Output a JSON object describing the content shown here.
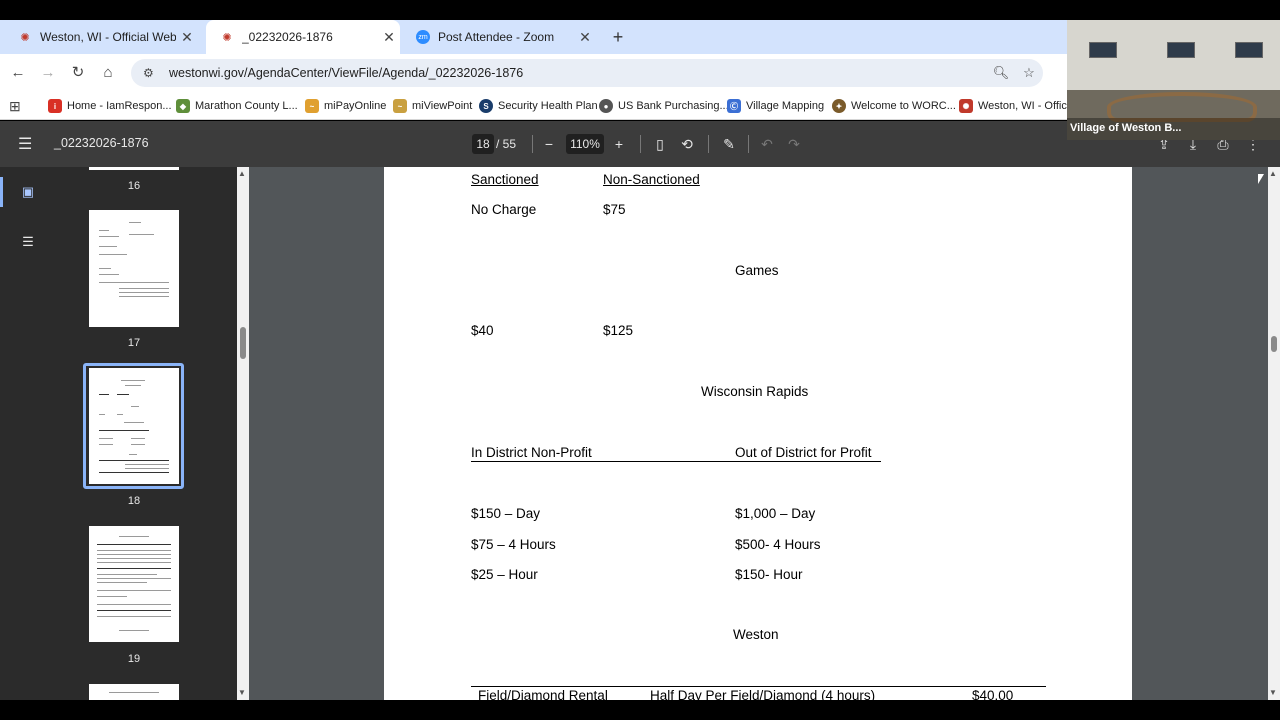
{
  "tabs": [
    {
      "title": "Weston, WI - Official Website |",
      "active": false
    },
    {
      "title": "_02232026-1876",
      "active": true
    },
    {
      "title": "Post Attendee - Zoom",
      "active": false
    }
  ],
  "new_tab_icon": "plus-icon",
  "address_bar": {
    "url": "westonwi.gov/AgendaCenter/ViewFile/Agenda/_02232026-1876"
  },
  "bookmarks": [
    {
      "label": "Home - IamRespon...",
      "color": "#d93025"
    },
    {
      "label": "Marathon County L...",
      "color": "#5f8f3b"
    },
    {
      "label": "miPayOnline",
      "color": "#e0a030"
    },
    {
      "label": "miViewPoint",
      "color": "#c9a040"
    },
    {
      "label": "Security Health Plan",
      "color": "#1a3d6b"
    },
    {
      "label": "US Bank Purchasing...",
      "color": "#555555"
    },
    {
      "label": "Village Mapping",
      "color": "#3b6fd4"
    },
    {
      "label": "Welcome to WORC...",
      "color": "#7a5a2a"
    },
    {
      "label": "Weston, WI - Officia",
      "color": "#c0392b"
    }
  ],
  "pdf_toolbar": {
    "doc_name": "_02232026-1876",
    "current_page": "18",
    "total_pages": "/ 55",
    "zoom": "110%"
  },
  "thumbnails": [
    {
      "label": "16"
    },
    {
      "label": "17"
    },
    {
      "label": "18"
    },
    {
      "label": "19"
    }
  ],
  "document": {
    "col1_header": "Sanctioned",
    "col2_header": "Non-Sanctioned",
    "no_charge": "No Charge",
    "non_sanct_practice": "$75",
    "games_heading": "Games",
    "games_sanct": "$40",
    "games_non_sanct": "$125",
    "wr_heading": "Wisconsin Rapids",
    "in_district": "In District Non-Profit",
    "out_district": "Out of District for Profit",
    "in_day": "$150 – Day",
    "in_4h": "$75 – 4 Hours",
    "in_hour": "$25 – Hour",
    "out_day": "$1,000 – Day",
    "out_4h": "$500- 4 Hours",
    "out_hour": "$150- Hour",
    "weston_heading": "Weston",
    "row1_label": "Field/Diamond Rental",
    "row1_desc": "Half Day Per Field/Diamond (4 hours)",
    "row1_price": "$40.00"
  },
  "zoom_overlay": {
    "caption": "Village of Weston B..."
  }
}
